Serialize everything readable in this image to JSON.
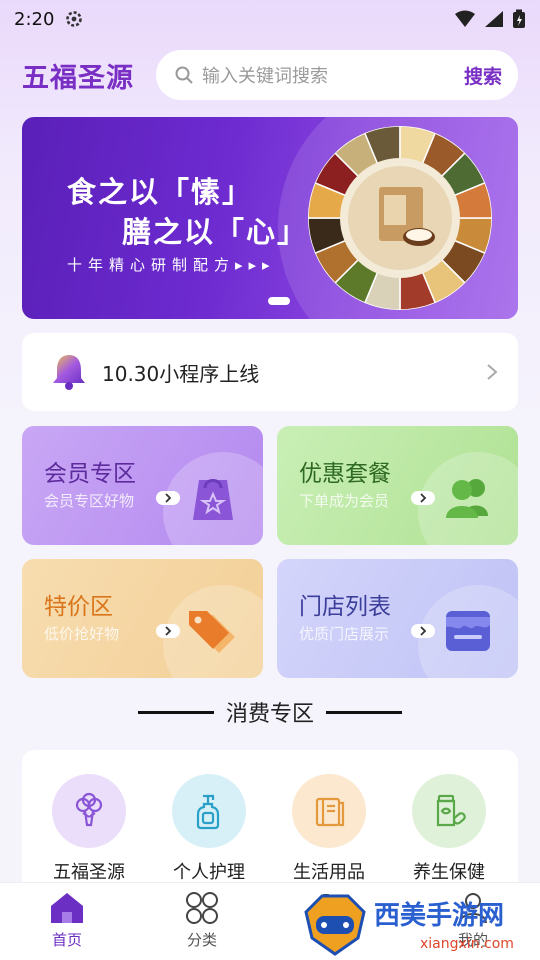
{
  "status_bar": {
    "time": "2:20"
  },
  "header": {
    "brand": "五福圣源",
    "search_placeholder": "输入关键词搜索",
    "search_button": "搜索"
  },
  "banner": {
    "line1": "食之以「愫」",
    "line2": "膳之以「心」",
    "line3": "十年精心研制配方▸▸▸"
  },
  "notice": {
    "text": "10.30小程序上线"
  },
  "cards": [
    {
      "title": "会员专区",
      "subtitle": "会员专区好物",
      "icon": "shopping-bag-icon"
    },
    {
      "title": "优惠套餐",
      "subtitle": "下单成为会员",
      "icon": "users-icon"
    },
    {
      "title": "特价区",
      "subtitle": "低价抢好物",
      "icon": "price-tag-icon"
    },
    {
      "title": "门店列表",
      "subtitle": "优质门店展示",
      "icon": "store-icon"
    }
  ],
  "section_title": "消费专区",
  "categories": [
    {
      "name": "五福圣源",
      "icon": "broccoli-icon",
      "color": "#ebdefa"
    },
    {
      "name": "个人护理",
      "icon": "pump-bottle-icon",
      "color": "#d7f0f8"
    },
    {
      "name": "生活用品",
      "icon": "book-icon",
      "color": "#fbe8cf"
    },
    {
      "name": "养生保健",
      "icon": "supplement-jar-icon",
      "color": "#dff1d8"
    }
  ],
  "tabbar": [
    {
      "label": "首页",
      "icon": "home-icon",
      "active": true
    },
    {
      "label": "分类",
      "icon": "grid-icon",
      "active": false
    },
    {
      "label": "",
      "icon": "cart-icon",
      "active": false
    },
    {
      "label": "我的",
      "icon": "user-icon",
      "active": false
    }
  ],
  "watermark": {
    "text": "西美手游网",
    "url": "xiangxin.com"
  },
  "colors": {
    "brand": "#7a2fc4",
    "tab_active": "#6b2fc4"
  }
}
